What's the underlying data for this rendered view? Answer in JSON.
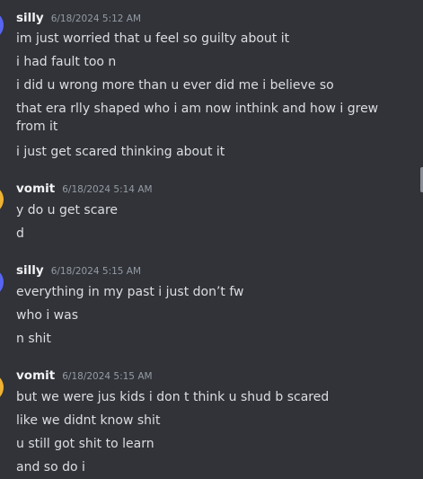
{
  "groups": [
    {
      "username": "silly",
      "timestamp": "6/18/2024 5:12 AM",
      "avatar_color": "#5865f2",
      "lines": [
        "im just worried that u feel so guilty about it",
        "i had fault too n",
        "i did u wrong more than u ever did me i believe so",
        "that era rlly shaped who i am now inthink and how i grew from it",
        "i just get scared thinking about it"
      ]
    },
    {
      "username": "vomit",
      "timestamp": "6/18/2024 5:14 AM",
      "avatar_color": "#f0b232",
      "lines": [
        "y do u get scare",
        "d"
      ]
    },
    {
      "username": "silly",
      "timestamp": "6/18/2024 5:15 AM",
      "avatar_color": "#5865f2",
      "lines": [
        "everything in my past i just don’t fw",
        "who i was",
        "n shit"
      ]
    },
    {
      "username": "vomit",
      "timestamp": "6/18/2024 5:15 AM",
      "avatar_color": "#f0b232",
      "lines": [
        "but we were jus kids i don t think u shud b scared",
        "like we didnt know shit",
        "u still got shit to learn",
        "and so do i"
      ]
    }
  ]
}
